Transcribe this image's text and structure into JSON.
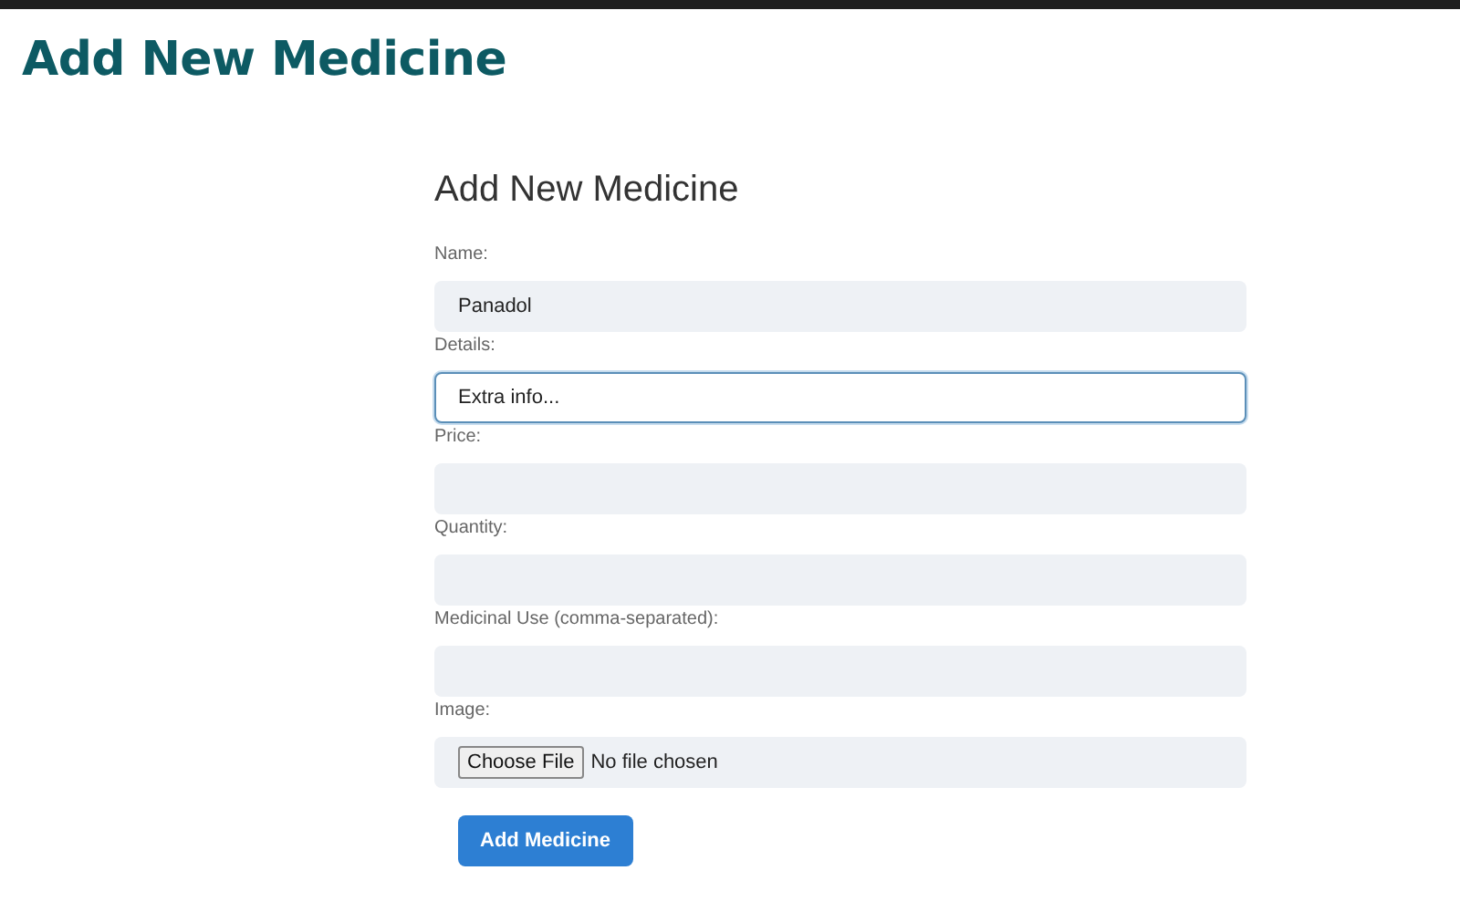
{
  "page_title": "Add New Medicine",
  "form": {
    "title": "Add New Medicine",
    "fields": [
      {
        "kind": "text",
        "label": "Name:",
        "value": "Panadol",
        "focused": false
      },
      {
        "kind": "text",
        "label": "Details:",
        "value": "Extra info...",
        "focused": true
      },
      {
        "kind": "text",
        "label": "Price:",
        "focused": false
      },
      {
        "kind": "text",
        "label": "Quantity:",
        "focused": false
      },
      {
        "kind": "text",
        "label": "Medicinal Use (comma-separated):",
        "focused": false
      },
      {
        "kind": "file",
        "label": "Image:",
        "button": "Choose File",
        "status": "No file chosen",
        "focused": false
      }
    ],
    "submit": "Add Medicine"
  }
}
